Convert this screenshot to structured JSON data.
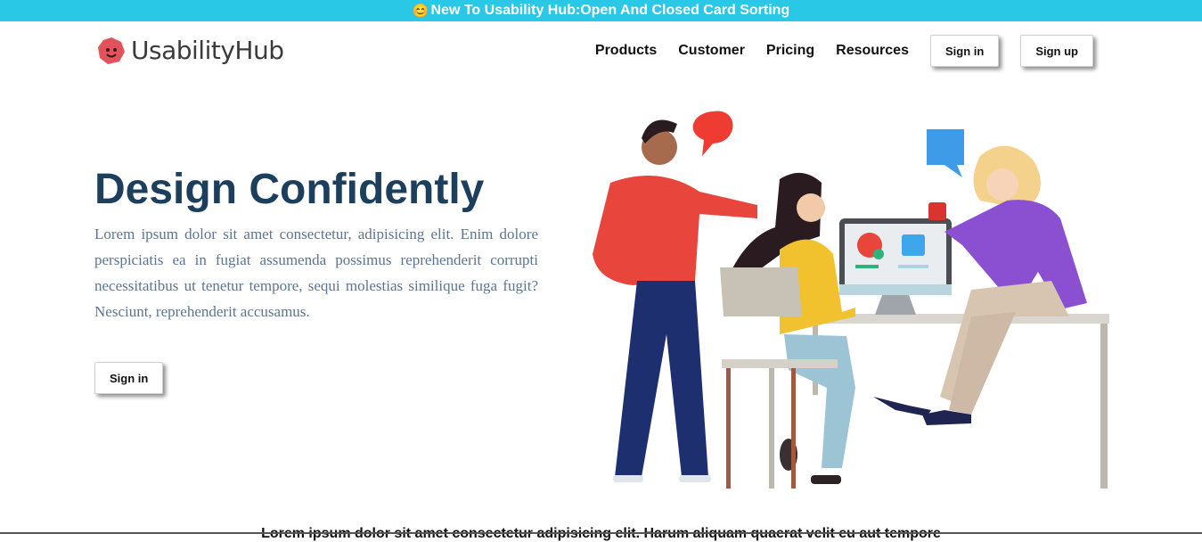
{
  "banner": {
    "emoji": "😊",
    "text": "New To Usability Hub:Open And Closed Card Sorting"
  },
  "logo": {
    "text": "UsabilityHub",
    "icon": "smiley-blob-icon"
  },
  "nav": {
    "items": [
      {
        "label": "Products"
      },
      {
        "label": "Customer"
      },
      {
        "label": "Pricing"
      },
      {
        "label": "Resources"
      }
    ],
    "sign_in": "Sign in",
    "sign_up": "Sign up"
  },
  "hero": {
    "title": "Design Confidently",
    "text": "Lorem ipsum dolor sit amet consectetur, adipisicing elit. Enim dolore perspiciatis ea in fugiat assumenda possimus reprehenderit corrupti necessitatibus ut tenetur tempore, sequi molestias similique fuga fugit? Nesciunt, reprehenderit accusamus.",
    "button": "Sign in"
  },
  "bottom": {
    "text": "Lorem ipsum dolor sit amet consectetur adipisicing elit. Harum aliquam quaerat velit eu aut tempore"
  },
  "colors": {
    "banner": "#29c8e6",
    "title": "#1d3f5e",
    "body_text": "#5d7591"
  }
}
